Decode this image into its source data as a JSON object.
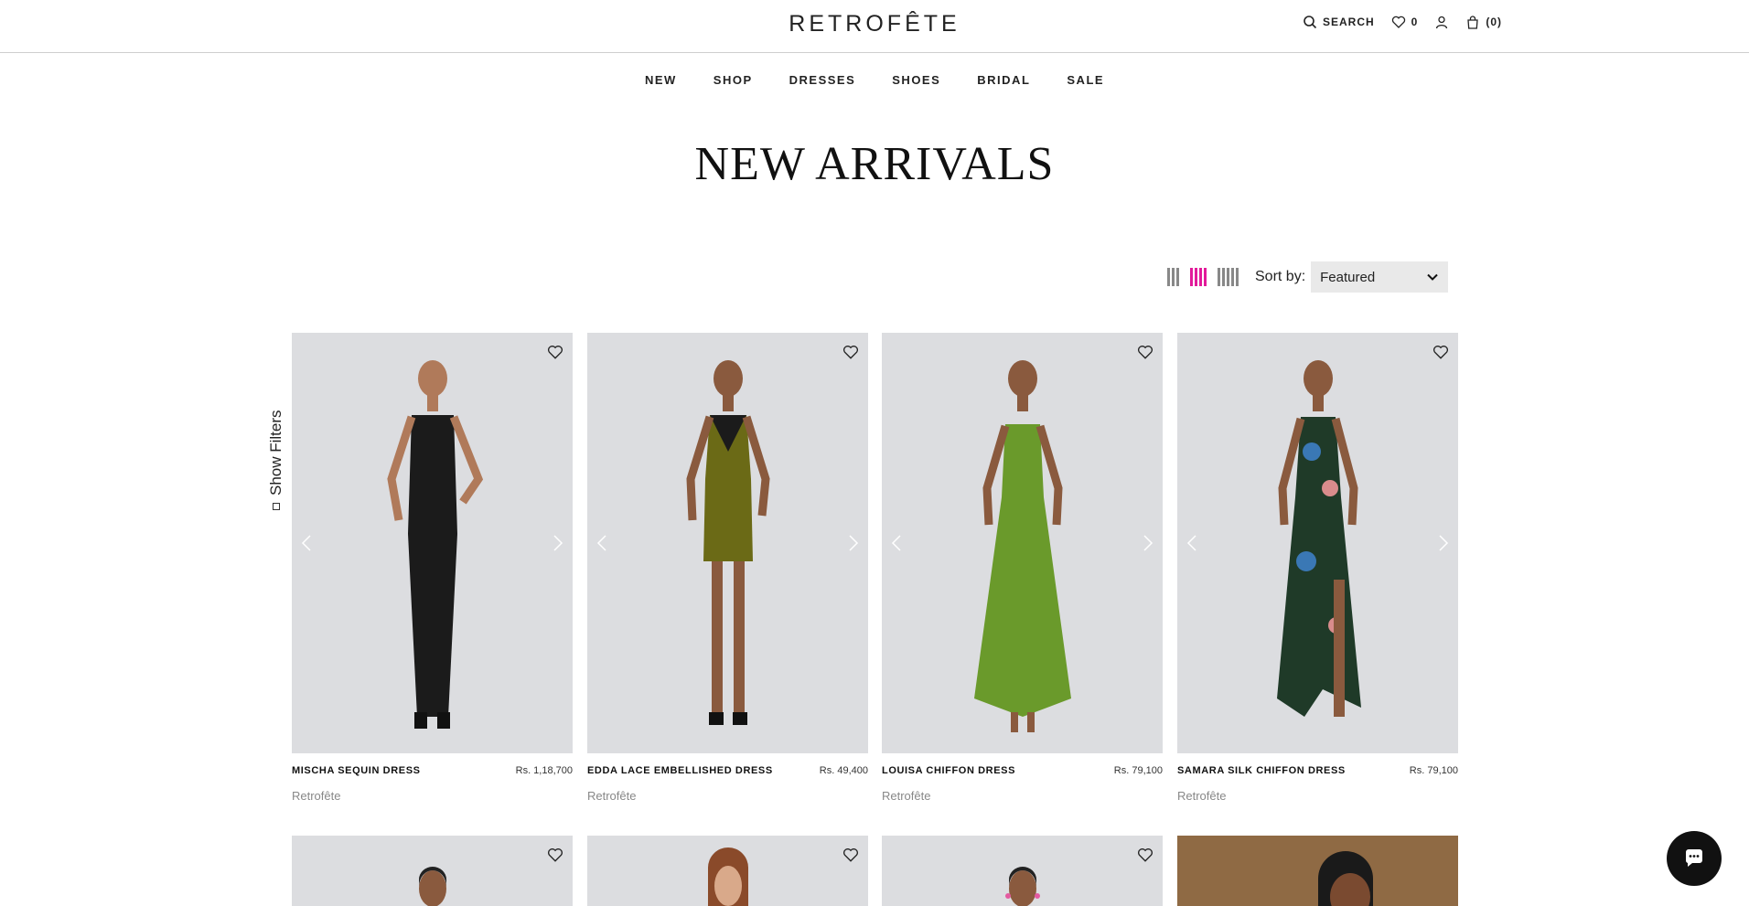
{
  "header": {
    "logo": "RETROFÊTE",
    "search_label": "SEARCH",
    "wishlist_count": "0",
    "cart_count": "(0)"
  },
  "nav": [
    "NEW",
    "SHOP",
    "DRESSES",
    "SHOES",
    "BRIDAL",
    "SALE"
  ],
  "page": {
    "title": "NEW ARRIVALS"
  },
  "toolbar": {
    "sort_label": "Sort by:",
    "sort_value": "Featured",
    "active_grid": "4-column",
    "accent_color": "#e21a9a"
  },
  "filters": {
    "label": "Show Filters"
  },
  "products": [
    {
      "name": "MISCHA SEQUIN DRESS",
      "price": "Rs. 1,18,700",
      "brand": "Retrofête",
      "dress_color": "#1b1b1b"
    },
    {
      "name": "EDDA LACE EMBELLISHED DRESS",
      "price": "Rs. 49,400",
      "brand": "Retrofête",
      "dress_color": "#6b6a16"
    },
    {
      "name": "LOUISA CHIFFON DRESS",
      "price": "Rs. 79,100",
      "brand": "Retrofête",
      "dress_color": "#6a9a2b"
    },
    {
      "name": "SAMARA SILK CHIFFON DRESS",
      "price": "Rs. 79,100",
      "brand": "Retrofête",
      "dress_color": "#1f3a28"
    }
  ],
  "chat": {
    "icon": "chat-bubble-icon"
  }
}
